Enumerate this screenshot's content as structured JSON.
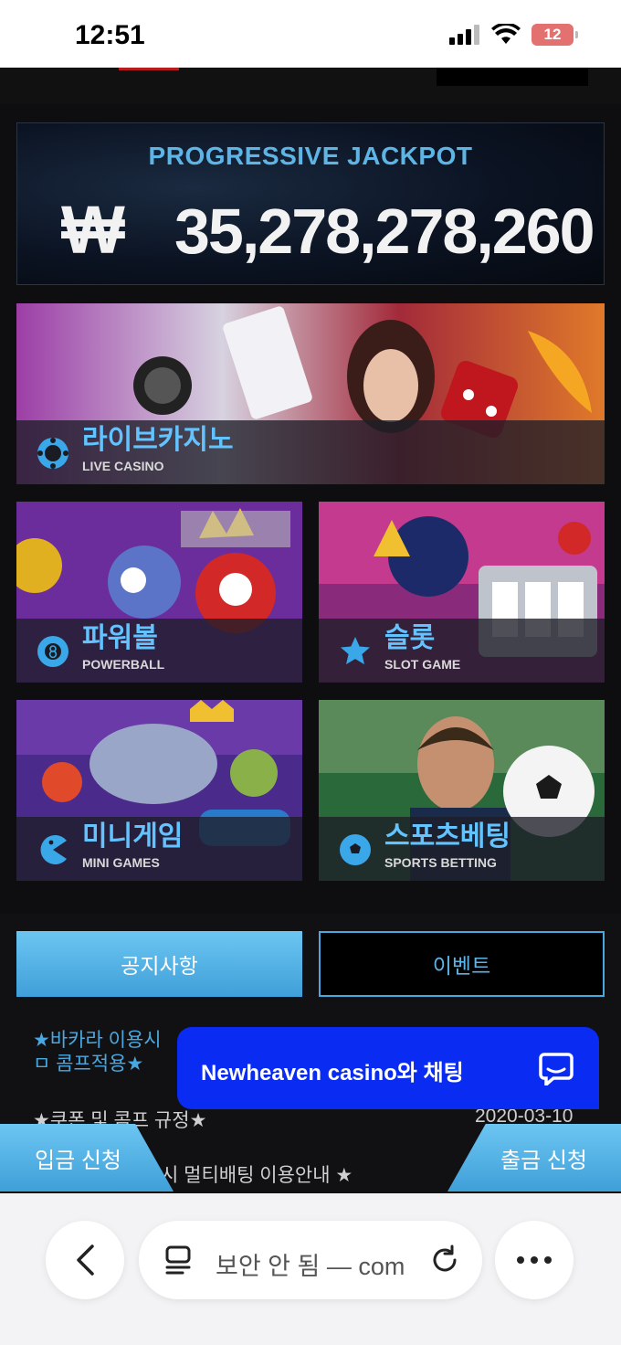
{
  "status": {
    "time": "12:51",
    "battery": "12"
  },
  "jackpot": {
    "title": "PROGRESSIVE JACKPOT",
    "currency": "₩",
    "amount": "35,278,278,260"
  },
  "tiles": [
    {
      "ko": "라이브카지노",
      "en": "LIVE CASINO"
    },
    {
      "ko": "파워볼",
      "en": "POWERBALL"
    },
    {
      "ko": "슬롯",
      "en": "SLOT GAME"
    },
    {
      "ko": "미니게임",
      "en": "MINI GAMES"
    },
    {
      "ko": "스포츠베팅",
      "en": "SPORTS BETTING"
    }
  ],
  "tabs": {
    "notice": "공지사항",
    "event": "이벤트"
  },
  "notices": [
    {
      "title": "★바카라 이용시 ㅁ 콤프적용★"
    },
    {
      "title": "★쿠폰 및 콤프 규정★",
      "date": "2020-03-10"
    },
    {
      "title": "시 멀티배팅 이용안내 ★"
    }
  ],
  "chat": {
    "label": "Newheaven casino와 채팅"
  },
  "side": {
    "deposit": "입금 신청",
    "withdraw": "출금 신청"
  },
  "browser": {
    "url": "보안 안 됨 — com"
  }
}
